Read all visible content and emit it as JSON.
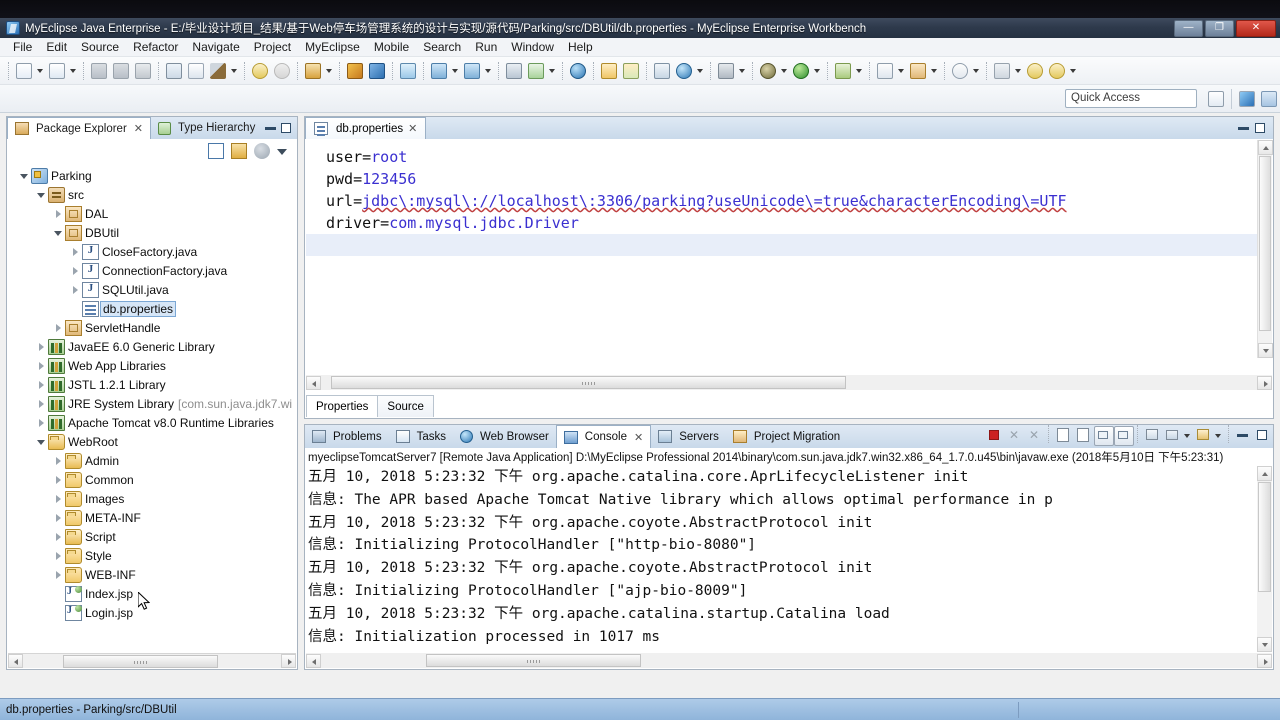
{
  "window": {
    "title": "MyEclipse Java Enterprise - E:/毕业设计项目_结果/基于Web停车场管理系统的设计与实现/源代码/Parking/src/DBUtil/db.properties - MyEclipse Enterprise Workbench",
    "minimize_label": "—",
    "maximize_label": "❐",
    "close_label": "✕"
  },
  "menu": {
    "items": [
      {
        "label": "File"
      },
      {
        "label": "Edit"
      },
      {
        "label": "Source"
      },
      {
        "label": "Refactor"
      },
      {
        "label": "Navigate"
      },
      {
        "label": "Project"
      },
      {
        "label": "MyEclipse"
      },
      {
        "label": "Mobile"
      },
      {
        "label": "Search"
      },
      {
        "label": "Run"
      },
      {
        "label": "Window"
      },
      {
        "label": "Help"
      }
    ]
  },
  "toolbar": {
    "icons": [
      "new-file-icon",
      "new-file-dropdown-icon",
      "new-wizard-icon",
      "new-wizard-dropdown-icon",
      "save-icon",
      "save-all-icon",
      "print-icon",
      "run-mobile-icon",
      "myeclipse-configuration-icon",
      "build-hammer-icon",
      "build-dropdown-icon",
      "undo-icon",
      "redo-icon",
      "deploy-icon",
      "deploy-dropdown-icon",
      "package-icon",
      "package-blue-icon",
      "web-preview-icon",
      "db-explorer-icon",
      "db-explorer-dropdown-icon",
      "db-browser-icon",
      "db-browser-dropdown-icon",
      "server-config-icon",
      "server-run-icon",
      "server-dropdown-icon",
      "open-web-icon",
      "open-resource-icon",
      "export-icon",
      "report-icon",
      "globe-search-icon",
      "globe-dropdown-icon",
      "snapshot-icon",
      "snapshot-dropdown-icon",
      "debug-icon",
      "debug-dropdown-icon",
      "run-icon",
      "run-dropdown-icon"
    ]
  },
  "quick_access": {
    "placeholder": "Quick Access",
    "value": "Quick Access",
    "open-perspective-icon": "open-perspective-icon",
    "perspective_myeclipse_java_enterprise": "myeclipse-java-enterprise-perspective-icon",
    "perspective_java_ee": "java-ee-perspective-icon"
  },
  "package_explorer": {
    "tabs": [
      {
        "label": "Package Explorer",
        "icon": "package-explorer-icon",
        "active": true,
        "closable": true
      },
      {
        "label": "Type Hierarchy",
        "icon": "type-hierarchy-icon",
        "active": false,
        "closable": false
      }
    ],
    "view_toolbar": [
      "collapse-all-icon",
      "link-with-editor-icon",
      "focus-on-active-task-icon",
      "view-menu-icon"
    ],
    "minimize_label": "—",
    "maximize_label": "❐",
    "tree": [
      {
        "label": "Parking",
        "indent": 0,
        "twisty": "open",
        "icon": "project-icon"
      },
      {
        "label": "src",
        "indent": 1,
        "twisty": "open",
        "icon": "source-folder-icon"
      },
      {
        "label": "DAL",
        "indent": 2,
        "twisty": "closed",
        "icon": "package-icon"
      },
      {
        "label": "DBUtil",
        "indent": 2,
        "twisty": "open",
        "icon": "package-icon"
      },
      {
        "label": "CloseFactory.java",
        "indent": 3,
        "twisty": "closed",
        "icon": "java-file-icon"
      },
      {
        "label": "ConnectionFactory.java",
        "indent": 3,
        "twisty": "closed",
        "icon": "java-file-icon"
      },
      {
        "label": "SQLUtil.java",
        "indent": 3,
        "twisty": "closed",
        "icon": "java-file-icon"
      },
      {
        "label": "db.properties",
        "indent": 3,
        "twisty": "none",
        "icon": "properties-file-icon",
        "selected": true
      },
      {
        "label": "ServletHandle",
        "indent": 2,
        "twisty": "closed",
        "icon": "package-icon"
      },
      {
        "label": "JavaEE 6.0 Generic Library",
        "indent": 1,
        "twisty": "closed",
        "icon": "library-icon"
      },
      {
        "label": "Web App Libraries",
        "indent": 1,
        "twisty": "closed",
        "icon": "library-icon"
      },
      {
        "label": "JSTL 1.2.1 Library",
        "indent": 1,
        "twisty": "closed",
        "icon": "library-icon"
      },
      {
        "label": "JRE System Library",
        "indent": 1,
        "twisty": "closed",
        "icon": "library-icon",
        "suffix": "[com.sun.java.jdk7.wi"
      },
      {
        "label": "Apache Tomcat v8.0 Runtime Libraries",
        "indent": 1,
        "twisty": "closed",
        "icon": "library-icon"
      },
      {
        "label": "WebRoot",
        "indent": 1,
        "twisty": "open",
        "icon": "folder-open-icon"
      },
      {
        "label": "Admin",
        "indent": 2,
        "twisty": "closed",
        "icon": "folder-open-icon"
      },
      {
        "label": "Common",
        "indent": 2,
        "twisty": "closed",
        "icon": "folder-icon"
      },
      {
        "label": "Images",
        "indent": 2,
        "twisty": "closed",
        "icon": "folder-icon"
      },
      {
        "label": "META-INF",
        "indent": 2,
        "twisty": "closed",
        "icon": "folder-icon"
      },
      {
        "label": "Script",
        "indent": 2,
        "twisty": "closed",
        "icon": "folder-open-icon"
      },
      {
        "label": "Style",
        "indent": 2,
        "twisty": "closed",
        "icon": "folder-icon"
      },
      {
        "label": "WEB-INF",
        "indent": 2,
        "twisty": "closed",
        "icon": "folder-icon"
      },
      {
        "label": "Index.jsp",
        "indent": 2,
        "twisty": "none",
        "icon": "jsp-file-icon"
      },
      {
        "label": "Login.jsp",
        "indent": 2,
        "twisty": "none",
        "icon": "jsp-file-icon"
      }
    ]
  },
  "editor": {
    "tab": {
      "label": "db.properties",
      "icon": "properties-file-icon",
      "close_label": "✕"
    },
    "minimize_label": "—",
    "maximize_label": "❐",
    "lines": [
      {
        "key": "user=",
        "value": "root"
      },
      {
        "key": "pwd=",
        "value": "123456"
      },
      {
        "key": "url=",
        "value": "jdbc\\:mysql\\://localhost\\:3306/parking?useUnicode\\=true&characterEncoding\\=UTF"
      },
      {
        "key": "driver=",
        "value": "com.mysql.jdbc.Driver"
      }
    ],
    "bottom_tabs": [
      {
        "label": "Properties",
        "active": true
      },
      {
        "label": "Source",
        "active": false
      }
    ]
  },
  "console": {
    "tabs": [
      {
        "label": "Problems",
        "icon": "problems-icon",
        "active": false
      },
      {
        "label": "Tasks",
        "icon": "tasks-icon",
        "active": false
      },
      {
        "label": "Web Browser",
        "icon": "web-browser-icon",
        "active": false
      },
      {
        "label": "Console",
        "icon": "console-icon",
        "active": true,
        "closable": true
      },
      {
        "label": "Servers",
        "icon": "servers-icon",
        "active": false
      },
      {
        "label": "Project Migration",
        "icon": "project-migration-icon",
        "active": false
      }
    ],
    "toolbar_icons": [
      "terminate-icon",
      "remove-launch-icon",
      "remove-all-terminated-icon",
      "save-console-icon",
      "lock-console-icon",
      "clear-console-icon",
      "scroll-lock-icon",
      "pin-console-icon",
      "display-selected-console-icon",
      "display-selected-dropdown-icon",
      "open-console-icon",
      "open-console-dropdown-icon"
    ],
    "minimize_label": "—",
    "maximize_label": "❐",
    "header": "myeclipseTomcatServer7 [Remote Java Application] D:\\MyEclipse Professional 2014\\binary\\com.sun.java.jdk7.win32.x86_64_1.7.0.u45\\bin\\javaw.exe (2018年5月10日 下午5:23:31)",
    "log_lines": [
      "五月 10, 2018 5:23:32 下午 org.apache.catalina.core.AprLifecycleListener init",
      "信息: The APR based Apache Tomcat Native library which allows optimal performance in p",
      "五月 10, 2018 5:23:32 下午 org.apache.coyote.AbstractProtocol init",
      "信息: Initializing ProtocolHandler [\"http-bio-8080\"]",
      "五月 10, 2018 5:23:32 下午 org.apache.coyote.AbstractProtocol init",
      "信息: Initializing ProtocolHandler [\"ajp-bio-8009\"]",
      "五月 10, 2018 5:23:32 下午 org.apache.catalina.startup.Catalina load",
      "信息: Initialization processed in 1017 ms"
    ]
  },
  "status_bar": {
    "text": "db.properties - Parking/src/DBUtil"
  },
  "colors": {
    "title_bar": "#2e3a4c",
    "tab_active": "#ffffff",
    "tab_inactive": "#c9d9ea",
    "selection": "#d6e6f7",
    "code_value": "#3a2fd0",
    "status_bar": "#9fc0e0",
    "caret_line": "#e8eef9"
  }
}
